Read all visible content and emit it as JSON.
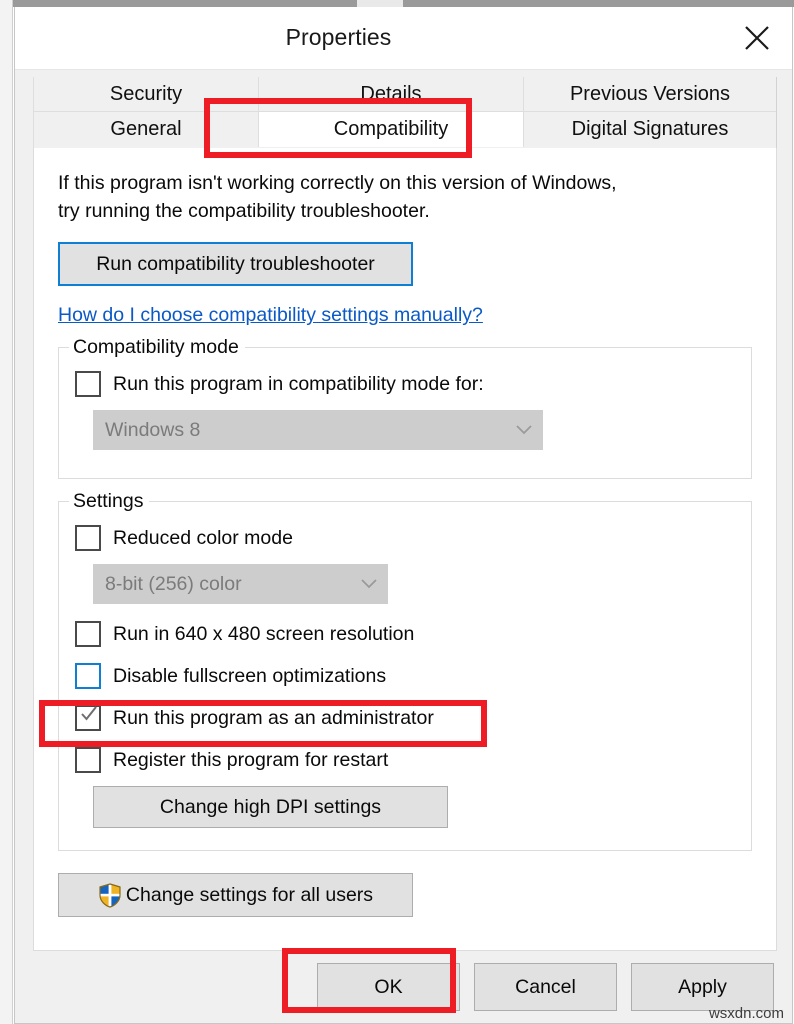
{
  "window": {
    "title": "Properties",
    "close_icon": "close-icon"
  },
  "tabs": {
    "row1": [
      {
        "label": "Security",
        "active": false
      },
      {
        "label": "Details",
        "active": false
      },
      {
        "label": "Previous Versions",
        "active": false
      }
    ],
    "row2": [
      {
        "label": "General",
        "active": false
      },
      {
        "label": "Compatibility",
        "active": true
      },
      {
        "label": "Digital Signatures",
        "active": false
      }
    ]
  },
  "compatibility_tab": {
    "intro_line1": "If this program isn't working correctly on this version of Windows,",
    "intro_line2": "try running the compatibility troubleshooter.",
    "troubleshoot_button": "Run compatibility troubleshooter",
    "help_link": "How do I choose compatibility settings manually?",
    "compatibility_mode": {
      "legend": "Compatibility mode",
      "checkbox_label": "Run this program in compatibility mode for:",
      "checkbox_checked": false,
      "dropdown_value": "Windows 8",
      "dropdown_disabled": true,
      "dropdown_caret": "chevron-down-icon"
    },
    "settings": {
      "legend": "Settings",
      "reduced_color_label": "Reduced color mode",
      "reduced_color_checked": false,
      "color_depth_value": "8-bit (256) color",
      "color_depth_disabled": true,
      "resolution_label": "Run in 640 x 480 screen resolution",
      "resolution_checked": false,
      "fullscreen_label": "Disable fullscreen optimizations",
      "fullscreen_checked": false,
      "admin_label": "Run this program as an administrator",
      "admin_checked": true,
      "restart_label": "Register this program for restart",
      "restart_checked": false,
      "dpi_button": "Change high DPI settings"
    },
    "all_users_button": "Change settings for all users",
    "all_users_icon": "uac-shield-icon"
  },
  "footer": {
    "ok": "OK",
    "cancel": "Cancel",
    "apply": "Apply",
    "watermark": "wsxdn.com"
  },
  "annotations": {
    "accent_color": "#ee1c25",
    "focus_color": "#0f7fd4",
    "link_color": "#0a59c6",
    "items": [
      {
        "target": "tab-compatibility"
      },
      {
        "target": "checkbox-run-as-administrator"
      },
      {
        "target": "ok-button"
      }
    ]
  }
}
